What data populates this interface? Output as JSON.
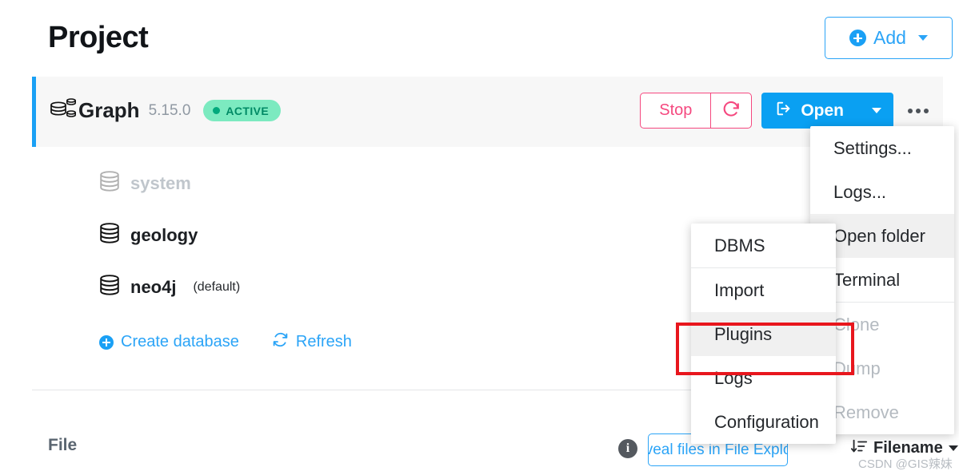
{
  "header": {
    "title": "Project",
    "add_button": {
      "label": "Add",
      "icon": "plus-circle-icon",
      "caret": "chevron-down-icon",
      "accent": "#2ba4f7"
    }
  },
  "dbms_card": {
    "icon": "graph-database-icon",
    "name": "Graph",
    "version": "5.15.0",
    "status_badge": {
      "label": "ACTIVE",
      "dot_color": "#01a97c",
      "background": "#7ceac0",
      "text_color": "#008a65"
    },
    "accent_bar_color": "#1aa0f5",
    "controls": {
      "stop_label": "Stop",
      "stop_color": "#f5487f",
      "restart_icon": "refresh-icon",
      "open_label": "Open",
      "open_icon": "open-external-icon",
      "open_caret": "chevron-down-icon",
      "open_color": "#0aa0f2",
      "more_icon": "ellipsis-icon"
    },
    "databases": [
      {
        "name": "system",
        "suffix": "",
        "disabled": true
      },
      {
        "name": "geology",
        "suffix": "",
        "disabled": false
      },
      {
        "name": "neo4j",
        "suffix": "(default)",
        "disabled": false
      }
    ],
    "actions": [
      {
        "label": "Create database",
        "icon": "plus-circle-icon"
      },
      {
        "label": "Refresh",
        "icon": "refresh-cycle-icon"
      }
    ]
  },
  "dbms_menu": {
    "items": [
      {
        "label": "Settings...",
        "state": "normal"
      },
      {
        "label": "Logs...",
        "state": "normal"
      },
      {
        "label": "Open folder",
        "state": "highlight"
      },
      {
        "label": "Terminal",
        "state": "normal"
      },
      {
        "label": "Clone",
        "state": "disabled"
      },
      {
        "label": "Dump",
        "state": "disabled"
      },
      {
        "label": "Remove",
        "state": "disabled"
      }
    ]
  },
  "submenu": {
    "header": "DBMS",
    "items": [
      {
        "label": "Import",
        "state": "normal"
      },
      {
        "label": "Plugins",
        "state": "highlight"
      },
      {
        "label": "Logs",
        "state": "normal"
      },
      {
        "label": "Configuration",
        "state": "normal"
      }
    ],
    "highlight_box_color": "#e8161d"
  },
  "file_section": {
    "label": "File",
    "info_icon": "info-icon",
    "info_glyph": "i",
    "reveal_button": "Reveal files in File Explorer",
    "sort_icon": "sort-descending-icon",
    "sort_label": "Filename",
    "sort_caret": "chevron-down-icon"
  },
  "watermark": "CSDN @GIS辣妹"
}
